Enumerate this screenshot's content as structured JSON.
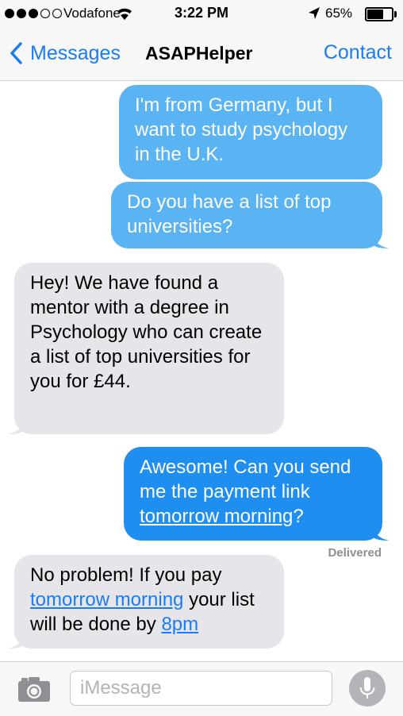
{
  "status_bar": {
    "carrier": "Vodafone",
    "time": "3:22 PM",
    "battery": "65%",
    "battery_level": 0.65,
    "signal_bars_filled": 3,
    "signal_bars_total": 5,
    "icons": [
      "wifi-icon",
      "location-arrow-icon",
      "battery-icon"
    ]
  },
  "nav": {
    "back_label": "Messages",
    "title": "ASAPHelper",
    "contact_label": "Contact"
  },
  "messages": [
    {
      "direction": "outgoing",
      "text": "I'm from Germany, but I want to study psychology in the U.K."
    },
    {
      "direction": "outgoing",
      "text": "Do you have a list of top universities?"
    },
    {
      "direction": "incoming",
      "text": "Hey! We have found a mentor with a degree in Psychology who can create a list of top universities for you for £44."
    },
    {
      "direction": "outgoing",
      "part1": "Awesome! Can you send me the payment link ",
      "link": "tomorrow morning",
      "part2": "?"
    },
    {
      "direction": "incoming",
      "part1": "No problem! If you pay ",
      "link1": "tomorrow morning",
      "part2": " your list will be done by ",
      "link2": "8pm"
    }
  ],
  "delivery_status": "Delivered",
  "composer": {
    "placeholder": "iMessage",
    "value": ""
  },
  "colors": {
    "accent": "#1a7cf5",
    "imessage_bubble": "#5ab3f2",
    "sms_bubble": "#1f8ef1",
    "incoming_bubble": "#e5e5ea"
  }
}
